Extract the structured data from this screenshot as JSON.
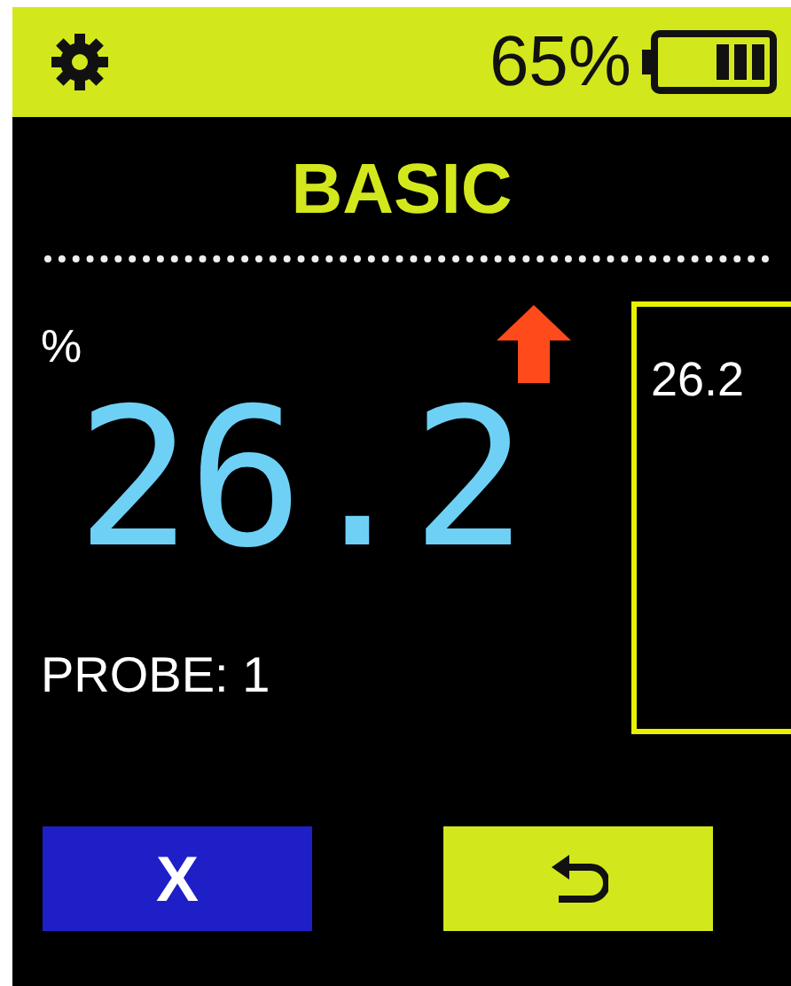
{
  "status_bar": {
    "battery": "65%"
  },
  "mode": "BASIC",
  "unit": "%",
  "rising": true,
  "reading": "26.2",
  "probe": "PROBE: 1",
  "side_panel": {
    "value": "26.2"
  },
  "buttons": [
    {
      "kind": "cancel",
      "label": "X"
    },
    {
      "kind": "back"
    }
  ]
}
